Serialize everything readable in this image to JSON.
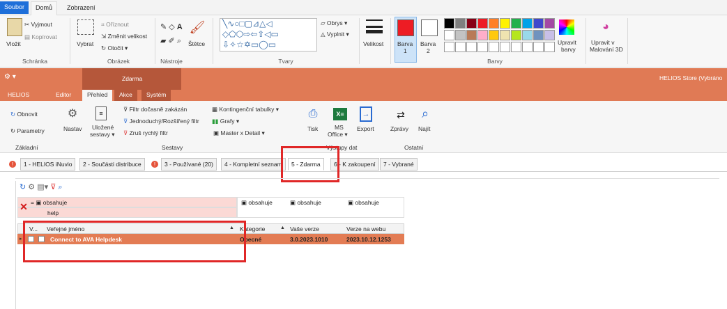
{
  "paint": {
    "tabs": [
      "Soubor",
      "Domů",
      "Zobrazení"
    ],
    "clipboard": {
      "paste": "Vložit",
      "cut": "Vyjmout",
      "copy": "Kopírovat",
      "label": "Schránka"
    },
    "image": {
      "select": "Vybrat",
      "crop": "Oříznout",
      "resize": "Změnit velikost",
      "rotate": "Otočit",
      "label": "Obrázek"
    },
    "tools": {
      "label": "Nástroje",
      "brushes": "Štětce"
    },
    "shapes": {
      "outline": "Obrys",
      "fill": "Vyplnit",
      "label": "Tvary"
    },
    "size": "Velikost",
    "color1": {
      "label": "Barva",
      "num": "1"
    },
    "color2": {
      "label": "Barva",
      "num": "2"
    },
    "edit_colors": [
      "Upravit",
      "barvy"
    ],
    "paint3d": [
      "Upravit v",
      "Malování 3D"
    ],
    "colors_label": "Barvy",
    "palette_colors": [
      "#000000",
      "#7f7f7f",
      "#880015",
      "#ed1c24",
      "#ff7f27",
      "#fff200",
      "#22b14c",
      "#00a2e8",
      "#3f48cc",
      "#a349a4",
      "#ffffff",
      "#c3c3c3",
      "#b97a57",
      "#ffaec9",
      "#ffc90e",
      "#efe4b0",
      "#b5e61d",
      "#99d9ea",
      "#7092be",
      "#c8bfe7"
    ]
  },
  "helios": {
    "title_tab": "Zdarma",
    "store_title": "HELIOS Store (Vybráno",
    "tabs": [
      "HELIOS",
      "Editor",
      "Přehled",
      "Akce",
      "Systém"
    ],
    "ribbon": {
      "refresh": "Obnovit",
      "params": "Parametry",
      "settings": "Nastav",
      "saved": "Uložené",
      "saved2": "sestavy",
      "basic": "Základní",
      "filter_disabled": "Filtr dočasně zakázán",
      "filter_simple": "Jednoduchý/Rozšířený filtr",
      "filter_cancel": "Zruš rychlý filtr",
      "pivot": "Kontingenční tabulky",
      "charts": "Grafy",
      "master": "Master x Detail",
      "reports": "Sestavy",
      "print": "Tisk",
      "office": "MS",
      "office2": "Office",
      "export": "Export",
      "outputs": "Výstupy dat",
      "messages": "Zprávy",
      "find": "Najít",
      "other": "Ostatní"
    },
    "doc_tabs": [
      "1 - HELIOS iNuvio",
      "2 - Součásti distribuce",
      "3 - Používané (20)",
      "4 - Kompletní seznam",
      "5 - Zdarma",
      "6 - K zakoupení",
      "7 - Vybrané"
    ],
    "filter": {
      "op": "obsahuje",
      "value": "help"
    },
    "columns": [
      "V...",
      "Veřejné jméno",
      "Kategorie",
      "Vaše verze",
      "Verze na webu"
    ],
    "rows": [
      {
        "name": "Connect to AVA Helpdesk",
        "category": "Obecné",
        "my_version": "3.0.2023.1010",
        "web_version": "2023.10.12.1253"
      }
    ]
  }
}
